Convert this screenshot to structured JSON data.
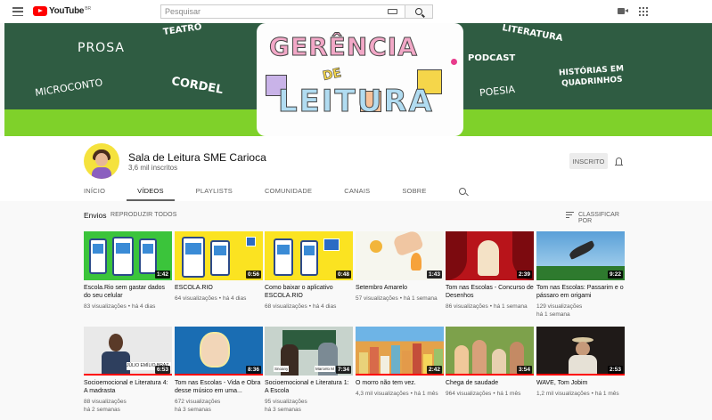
{
  "topbar": {
    "logo_text": "YouTube",
    "logo_country": "BR",
    "search_placeholder": "Pesquisar"
  },
  "banner": {
    "words": [
      "PROSA",
      "TEATRO",
      "MICROCONTO",
      "CORDEL",
      "LITERATURA",
      "PODCAST",
      "HISTÓRIAS EM QUADRINHOS",
      "POESIA"
    ],
    "art_title_line1": "GERÊNCIA",
    "art_title_line2": "DE",
    "art_title_line3": "LEITURA"
  },
  "channel": {
    "name": "Sala de Leitura SME Carioca",
    "subscribers": "3,6 mil inscritos",
    "subscribe_label": "INSCRITO"
  },
  "tabs": [
    "INÍCIO",
    "VÍDEOS",
    "PLAYLISTS",
    "COMUNIDADE",
    "CANAIS",
    "SOBRE"
  ],
  "active_tab": "VÍDEOS",
  "section": {
    "title": "Envios",
    "play_all": "REPRODUZIR TODOS",
    "sort_label": "CLASSIFICAR POR"
  },
  "videos": [
    {
      "title": "Escola.Rio sem gastar dados do seu celular",
      "views": "83 visualizações",
      "age": "há 4 dias",
      "duration": "1:42",
      "progress": 0
    },
    {
      "title": "ESCOLA.RIO",
      "views": "64 visualizações",
      "age": "há 4 dias",
      "duration": "0:56",
      "progress": 0
    },
    {
      "title": "Como baixar o aplicativo ESCOLA.RIO",
      "views": "68 visualizações",
      "age": "há 4 dias",
      "duration": "0:48",
      "progress": 0
    },
    {
      "title": "Setembro Amarelo",
      "views": "57 visualizações",
      "age": "há 1 semana",
      "duration": "1:43",
      "progress": 0
    },
    {
      "title": "Tom nas Escolas - Concurso de Desenhos",
      "views": "86 visualizações",
      "age": "há 1 semana",
      "duration": "2:39",
      "progress": 0
    },
    {
      "title": "Tom nas Escolas: Passarim e o pássaro em origami",
      "views": "129 visualizações",
      "age": "há 1 semana",
      "duration": "9:22",
      "progress": 0
    },
    {
      "title": "Socioemocional e Literatura 4: A madrasta",
      "views": "88 visualizações",
      "age": "há 2 semanas",
      "duration": "6:53",
      "progress": 1.0,
      "caption": "JÚLIO EMÍLIO BRAZ"
    },
    {
      "title": "Tom nas Escolas - Vida e Obra desse músico em uma...",
      "views": "672 visualizações",
      "age": "há 3 semanas",
      "duration": "8:36",
      "progress": 1.0
    },
    {
      "title": "Socioemocional e Literatura 1: A Escola",
      "views": "95 visualizações",
      "age": "há 3 semanas",
      "duration": "7:34",
      "progress": 0,
      "labels": [
        "Snoany",
        "Marcelo M"
      ]
    },
    {
      "title": "O morro não tem vez.",
      "views": "4,3 mil visualizações",
      "age": "há 1 mês",
      "duration": "2:42",
      "progress": 1.0
    },
    {
      "title": "Chega de saudade",
      "views": "964 visualizações",
      "age": "há 1 mês",
      "duration": "3:54",
      "progress": 1.0
    },
    {
      "title": "WAVE, Tom Jobim",
      "views": "1,2 mil visualizações",
      "age": "há 1 mês",
      "duration": "2:53",
      "progress": 1.0
    }
  ],
  "colors": {
    "youtube_red": "#ff0000",
    "banner_green": "#2f5c42",
    "banner_light_green": "#7fd12a",
    "avatar_yellow": "#f5e23d"
  }
}
